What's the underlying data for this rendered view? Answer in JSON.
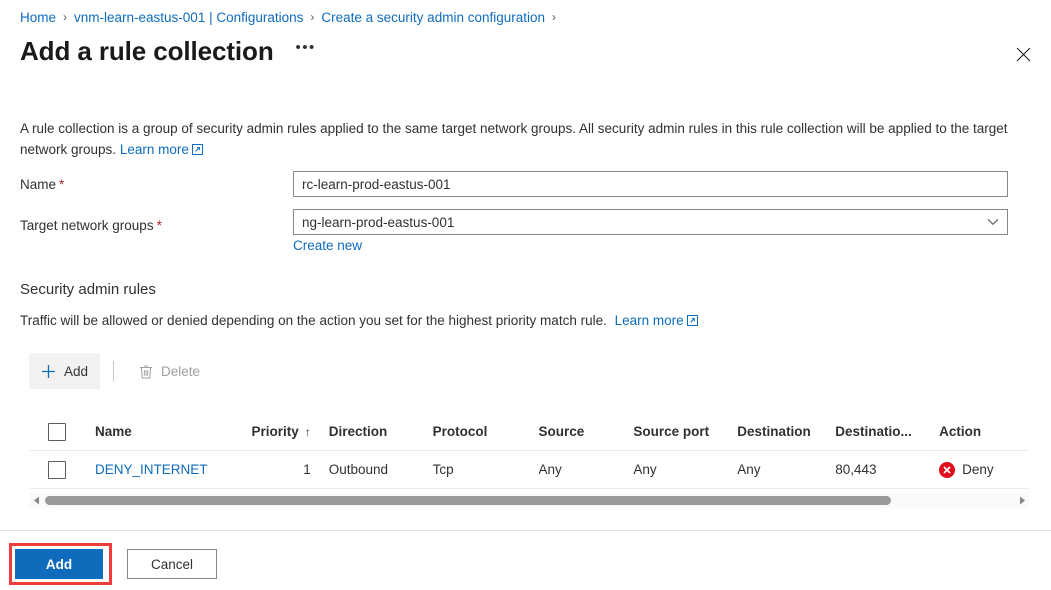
{
  "breadcrumb": {
    "items": [
      {
        "label": "Home"
      },
      {
        "label": "vnm-learn-eastus-001 | Configurations"
      },
      {
        "label": "Create a security admin configuration"
      }
    ],
    "separator": "›"
  },
  "header": {
    "title": "Add a rule collection",
    "more_label": "•••",
    "close_icon": "close-icon"
  },
  "description": {
    "text": "A rule collection is a group of security admin rules applied to the same target network groups. All security admin rules in this rule collection will be applied to the target network groups.",
    "learn_more_label": "Learn more"
  },
  "form": {
    "name": {
      "label": "Name",
      "required_marker": "*",
      "value": "rc-learn-prod-eastus-001",
      "placeholder": ""
    },
    "target_network_groups": {
      "label": "Target network groups",
      "required_marker": "*",
      "value": "ng-learn-prod-eastus-001",
      "chevron_icon": "chevron-down-icon",
      "create_new_label": "Create new"
    }
  },
  "rules_section": {
    "heading": "Security admin rules",
    "subtext": "Traffic will be allowed or denied depending on the action you set for the highest priority match rule.",
    "learn_more_label": "Learn more",
    "toolbar": {
      "add_label": "Add",
      "add_icon": "plus-icon",
      "delete_label": "Delete",
      "delete_icon": "trash-icon",
      "delete_disabled": true
    },
    "table": {
      "columns": [
        "Name",
        "Priority",
        "Direction",
        "Protocol",
        "Source",
        "Source port",
        "Destination",
        "Destinatio...",
        "Action"
      ],
      "sort_column": "Priority",
      "sort_indicator": "↑",
      "rows": [
        {
          "name": "DENY_INTERNET",
          "priority": "1",
          "direction": "Outbound",
          "protocol": "Tcp",
          "source": "Any",
          "source_port": "Any",
          "destination": "Any",
          "destination_port": "80,443",
          "action": "Deny",
          "action_icon": "deny-circle-x-icon"
        }
      ],
      "scroll_percent": 87
    }
  },
  "footer": {
    "add_label": "Add",
    "cancel_label": "Cancel"
  },
  "colors": {
    "accent": "#0f6cbd",
    "link": "#0f6cbd",
    "required": "#a4262c",
    "deny": "#e00b1c",
    "highlight": "#ef3b3b",
    "text": "#323130",
    "disabled": "#a19f9d"
  }
}
